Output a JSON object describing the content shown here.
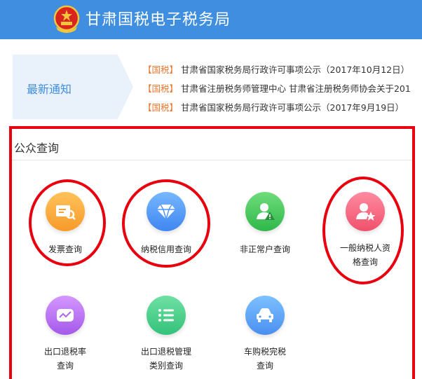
{
  "header": {
    "title": "甘肃国税电子税务局",
    "emblem_icon": "national-emblem-icon"
  },
  "notice": {
    "label": "最新通知",
    "items": [
      {
        "tag": "【国税】",
        "text": "甘肃省国家税务局行政许可事项公示（2017年10月12日）"
      },
      {
        "tag": "【国税】",
        "text": "甘肃省注册税务师管理中心 甘肃省注册税务师协会关于201"
      },
      {
        "tag": "【国税】",
        "text": "甘肃省国家税务局行政许可事项公示（2017年9月19日）"
      }
    ]
  },
  "panel": {
    "title": "公众查询",
    "tiles": [
      {
        "label": "发票查询",
        "icon": "invoice-search-icon",
        "color": "#f7a33a",
        "circled": true
      },
      {
        "label": "纳税信用查询",
        "icon": "diamond-icon",
        "color": "#4f95f5",
        "circled": true
      },
      {
        "label": "非正常户查询",
        "icon": "user-warning-icon",
        "color": "#3cc258",
        "circled": false
      },
      {
        "label_line1": "一般纳税人资",
        "label_line2": "格查询",
        "icon": "user-star-icon",
        "color": "#f45f79",
        "circled": true
      },
      {
        "label_line1": "出口退税率",
        "label_line2": "查询",
        "icon": "trend-chart-icon",
        "color": "#b066ef",
        "circled": false
      },
      {
        "label_line1": "出口退税管理",
        "label_line2": "类别查询",
        "icon": "list-icon",
        "color": "#3ecb84",
        "circled": false
      },
      {
        "label_line1": "车购税完税",
        "label_line2": "查询",
        "icon": "car-icon",
        "color": "#5a9cf3",
        "circled": false
      }
    ]
  },
  "colors": {
    "header_bg": "#3f8ee0",
    "highlight_red": "#e8000e",
    "tag_orange": "#e8782f"
  }
}
